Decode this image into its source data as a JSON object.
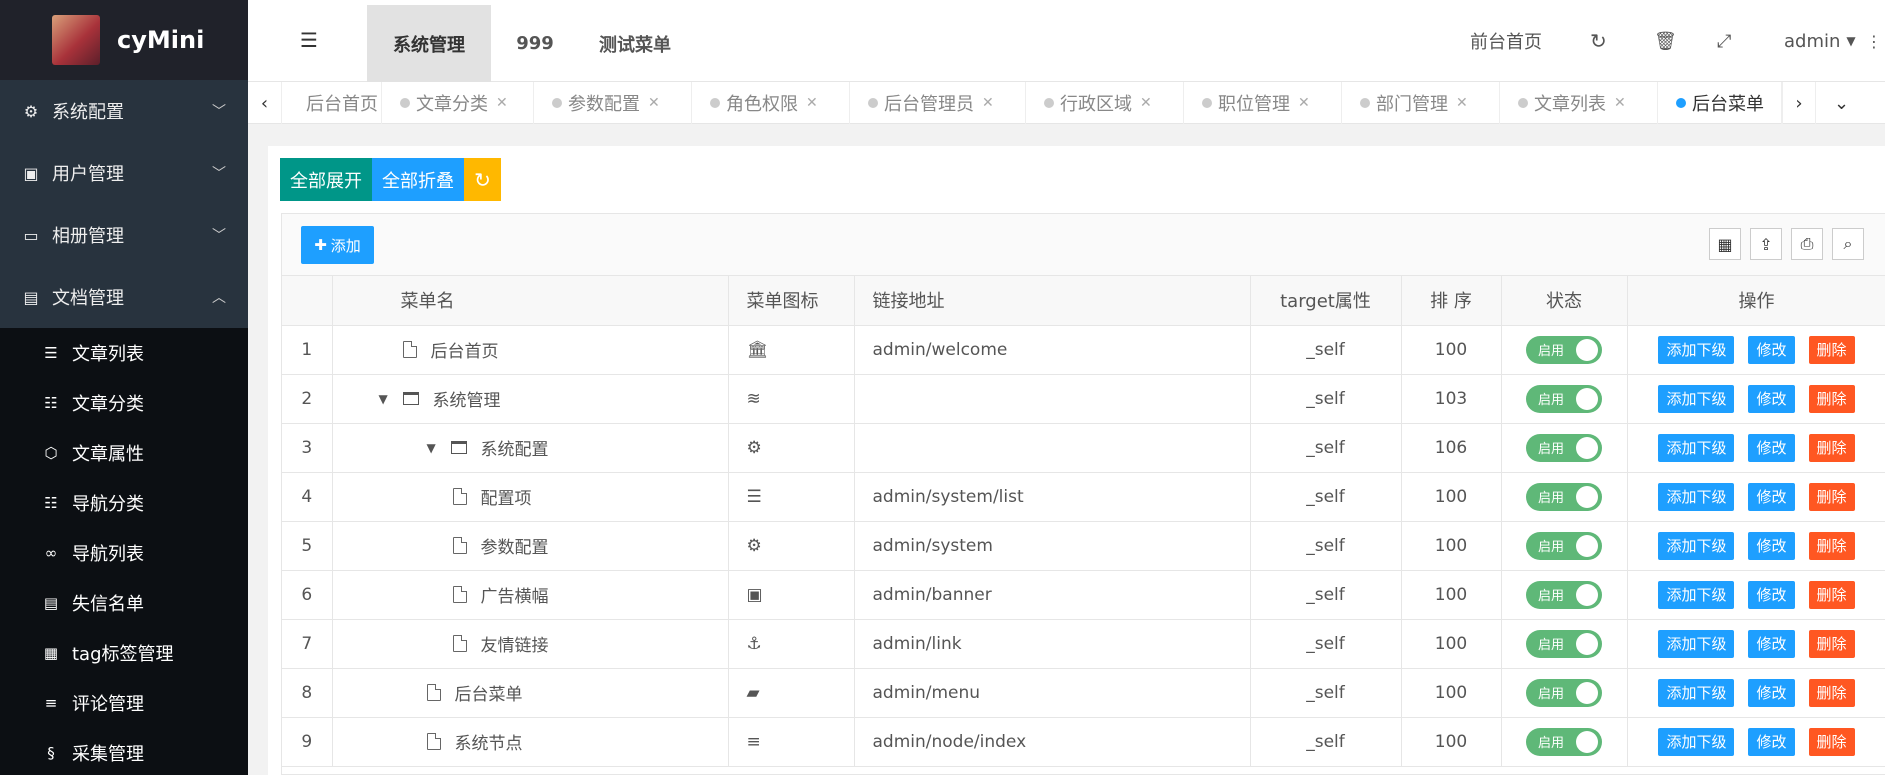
{
  "app": {
    "brand": "cyMini"
  },
  "sidebar": {
    "groups": [
      {
        "label": "系统配置",
        "icon": "gears-icon",
        "arrow": "﹀"
      },
      {
        "label": "用户管理",
        "icon": "user-card-icon",
        "arrow": "﹀"
      },
      {
        "label": "相册管理",
        "icon": "folder-icon",
        "arrow": "﹀"
      },
      {
        "label": "文档管理",
        "icon": "id-card-icon",
        "arrow": "︿"
      }
    ],
    "doc_items": [
      {
        "label": "文章列表",
        "icon": "list-icon"
      },
      {
        "label": "文章分类",
        "icon": "indent-icon"
      },
      {
        "label": "文章属性",
        "icon": "cube-icon"
      },
      {
        "label": "导航分类",
        "icon": "indent-icon"
      },
      {
        "label": "导航列表",
        "icon": "link-icon"
      },
      {
        "label": "失信名单",
        "icon": "id-card-icon"
      },
      {
        "label": "tag标签管理",
        "icon": "cc-icon"
      },
      {
        "label": "评论管理",
        "icon": "align-icon"
      },
      {
        "label": "采集管理",
        "icon": "paperclip-icon"
      }
    ]
  },
  "header": {
    "top_tabs": [
      "系统管理",
      "999",
      "测试菜单"
    ],
    "front_home": "前台首页",
    "user": "admin"
  },
  "tabbar": {
    "tabs": [
      "后台首页",
      "文章分类",
      "参数配置",
      "角色权限",
      "后台管理员",
      "行政区域",
      "职位管理",
      "部门管理",
      "文章列表",
      "后台菜单"
    ],
    "active": "后台菜单"
  },
  "buttons": {
    "expand_all": "全部展开",
    "collapse_all": "全部折叠",
    "add": "添加"
  },
  "table": {
    "headers": [
      "菜单名",
      "菜单图标",
      "链接地址",
      "target属性",
      "排 序",
      "状态",
      "操作"
    ],
    "status_on": "启用",
    "ops": [
      "添加下级",
      "修改",
      "删除"
    ],
    "rows": [
      {
        "idx": "1",
        "name": "后台首页",
        "level": 0,
        "type": "page",
        "icon": "🏛",
        "icon_name": "bank-icon",
        "url": "admin/welcome",
        "target": "_self",
        "sort": "100"
      },
      {
        "idx": "2",
        "name": "系统管理",
        "level": 0,
        "type": "folder",
        "icon": "≋",
        "icon_name": "database-icon",
        "url": "",
        "target": "_self",
        "sort": "103"
      },
      {
        "idx": "3",
        "name": "系统配置",
        "level": 1,
        "type": "folder",
        "icon": "⚙",
        "icon_name": "gears-icon",
        "url": "",
        "target": "_self",
        "sort": "106"
      },
      {
        "idx": "4",
        "name": "配置项",
        "level": 2,
        "type": "page",
        "icon": "☰",
        "icon_name": "list-ol-icon",
        "url": "admin/system/list",
        "target": "_self",
        "sort": "100"
      },
      {
        "idx": "5",
        "name": "参数配置",
        "level": 2,
        "type": "page",
        "icon": "⚙",
        "icon_name": "gear-icon",
        "url": "admin/system",
        "target": "_self",
        "sort": "100"
      },
      {
        "idx": "6",
        "name": "广告横幅",
        "level": 2,
        "type": "page",
        "icon": "▣",
        "icon_name": "image-icon",
        "url": "admin/banner",
        "target": "_self",
        "sort": "100"
      },
      {
        "idx": "7",
        "name": "友情链接",
        "level": 2,
        "type": "page",
        "icon": "⚓",
        "icon_name": "anchor-icon",
        "url": "admin/link",
        "target": "_self",
        "sort": "100"
      },
      {
        "idx": "8",
        "name": "后台菜单",
        "level": 1,
        "type": "page",
        "icon": "▰",
        "icon_name": "book-icon",
        "url": "admin/menu",
        "target": "_self",
        "sort": "100"
      },
      {
        "idx": "9",
        "name": "系统节点",
        "level": 1,
        "type": "page",
        "icon": "≡",
        "icon_name": "align-icon",
        "url": "admin/node/index",
        "target": "_self",
        "sort": "100"
      }
    ]
  },
  "colors": {
    "sidebar_bg": "#28333e",
    "submenu_bg": "#0c0f13",
    "green": "#009688",
    "blue": "#1e9fff",
    "orange": "#ffb800",
    "red": "#ff5722",
    "switch_on": "#5fb878"
  }
}
